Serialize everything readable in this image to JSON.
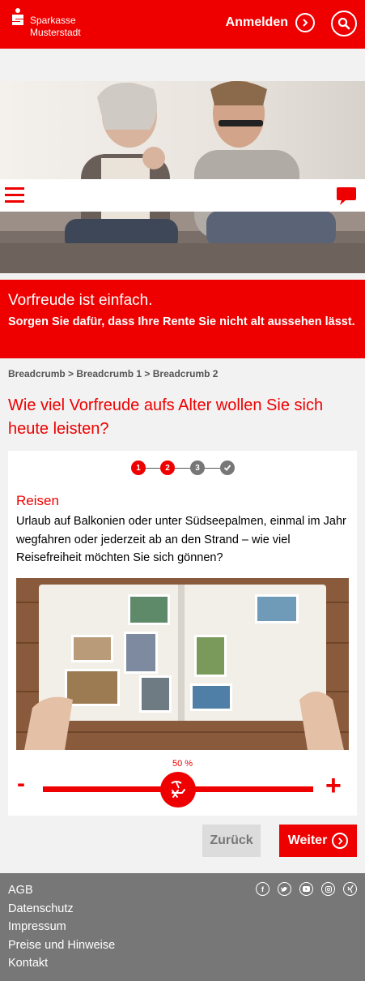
{
  "header": {
    "brand_line1": "Sparkasse",
    "brand_line2": "Musterstadt",
    "login_label": "Anmelden",
    "icons": [
      "sparkasse-logo",
      "chevron-right-icon",
      "search-icon"
    ]
  },
  "nav": {
    "icons": [
      "menu-icon",
      "chat-icon"
    ]
  },
  "teaser": {
    "title": "Vorfreude ist einfach.",
    "subtitle": "Sorgen Sie dafür, dass Ihre Rente Sie nicht alt aussehen lässt."
  },
  "breadcrumb": {
    "items": [
      "Breadcrumb",
      "Breadcrumb 1",
      "Breadcrumb 2"
    ],
    "separator": " > "
  },
  "page_title": "Wie viel Vorfreude aufs Alter wollen Sie sich heute leisten?",
  "stepper": {
    "steps": [
      "1",
      "2",
      "3"
    ],
    "current": 2,
    "final_icon": "check-icon"
  },
  "card": {
    "title": "Reisen",
    "text": "Urlaub auf Balkonien oder unter Südseepalmen, einmal im Jahr wegfahren oder jederzeit ab an den Strand – wie viel Reisefreiheit möchten Sie sich gönnen?"
  },
  "slider": {
    "value_label": "50 %",
    "value_fraction": 0.5,
    "minus_label": "-",
    "plus_label": "+",
    "thumb_icon": "beach-chair-icon"
  },
  "buttons": {
    "back_label": "Zurück",
    "next_label": "Weiter"
  },
  "footer": {
    "links": [
      "AGB",
      "Datenschutz",
      "Impressum",
      "Preise und Hinweise",
      "Kontakt"
    ],
    "social_icons": [
      "facebook-icon",
      "twitter-icon",
      "youtube-icon",
      "instagram-icon",
      "xing-icon"
    ]
  },
  "colors": {
    "brand_red": "#ee0000",
    "footer_gray": "#777777",
    "page_bg": "#f2f2f2",
    "step_done": "#ee0000",
    "step_todo": "#777777"
  }
}
